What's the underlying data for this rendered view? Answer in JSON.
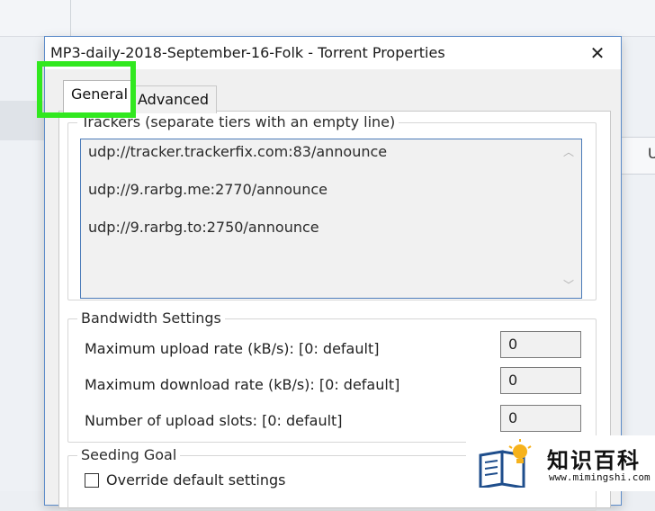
{
  "dialog": {
    "title": "MP3-daily-2018-September-16-Folk - Torrent Properties",
    "close_label": "✕"
  },
  "tabs": [
    {
      "label": "General",
      "active": true
    },
    {
      "label": "Advanced",
      "active": false
    }
  ],
  "trackers": {
    "label": "Trackers (separate tiers with an empty line)",
    "lines": [
      "udp://tracker.trackerfix.com:83/announce",
      "udp://9.rarbg.me:2770/announce",
      "udp://9.rarbg.to:2750/announce"
    ]
  },
  "bandwidth": {
    "label": "Bandwidth Settings",
    "fields": [
      {
        "label": "Maximum upload rate (kB/s): [0: default]",
        "value": "0"
      },
      {
        "label": "Maximum download rate (kB/s): [0: default]",
        "value": "0"
      },
      {
        "label": "Number of upload slots: [0: default]",
        "value": "0"
      }
    ]
  },
  "seeding": {
    "label": "Seeding Goal",
    "override_label": "Override default settings"
  },
  "background": {
    "column_header_fragment": "U"
  },
  "watermark": {
    "title": "知识百科",
    "url": "www.mimingshi.com"
  },
  "colors": {
    "highlight": "#31e81f",
    "dialog_border": "#5b8bc9",
    "tracker_border": "#4a7ab8"
  }
}
